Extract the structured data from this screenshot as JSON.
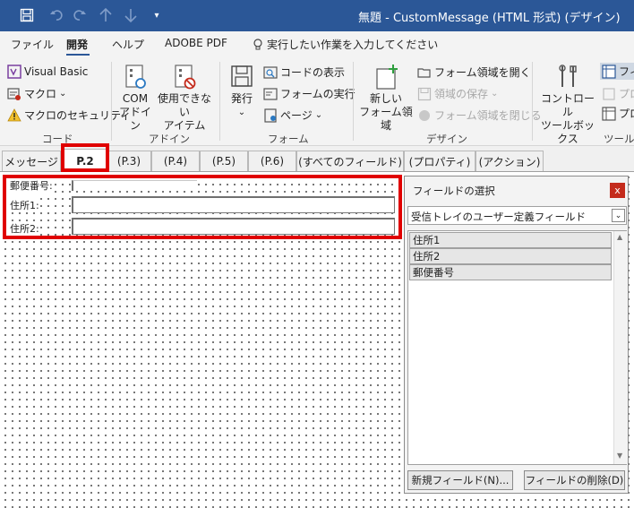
{
  "window": {
    "title": "無題 - CustomMessage (HTML 形式) (デザイン)",
    "quick_access": [
      "save-icon",
      "undo-icon",
      "redo-icon",
      "up-arrow-icon",
      "down-arrow-icon",
      "customize-qat-icon"
    ],
    "qat_glyphs": {
      "save": "🖫",
      "undo": "↶",
      "redo": "↻",
      "up": "↑",
      "down": "↓",
      "customize": "▾"
    },
    "accent_color": "#2b5797"
  },
  "menu": {
    "items": [
      "ファイル",
      "開発",
      "ヘルプ",
      "ADOBE PDF"
    ],
    "active": "開発",
    "tell_me": "実行したい作業を入力してください"
  },
  "ribbon": {
    "code": {
      "label": "コード",
      "visual_basic": "Visual Basic",
      "macro": "マクロ",
      "macro_security": "マクロのセキュリティ"
    },
    "addins": {
      "label": "アドイン",
      "com_addins_line1": "COM",
      "com_addins_line2": "アドイン",
      "disabled_items_line1": "使用できない",
      "disabled_items_line2": "アイテム"
    },
    "form": {
      "label": "フォーム",
      "publish": "発行",
      "view_code": "コードの表示",
      "run_form": "フォームの実行",
      "page": "ページ"
    },
    "design": {
      "label": "デザイン",
      "new_region_line1": "新しい",
      "new_region_line2": "フォーム領域",
      "open_region": "フォーム領域を開く",
      "save_region": "領域の保存",
      "close_region": "フォーム領域を閉じる"
    },
    "tools": {
      "label": "ツール",
      "control_toolbox_line1": "コントロール",
      "control_toolbox_line2": "ツールボックス",
      "field_chooser_partial": "フィー",
      "properties_partial": "プロ",
      "properties2_partial": "プロ"
    },
    "caret": "⌄",
    "dropdown_caret": "⌄"
  },
  "page_tabs": {
    "items": [
      "メッセージ",
      "P.2",
      "(P.3)",
      "(P.4)",
      "(P.5)",
      "(P.6)",
      "(すべてのフィールド)",
      "(プロパティ)",
      "(アクション)"
    ],
    "active": "P.2",
    "highlight_color": "#e00000"
  },
  "form_fields": [
    {
      "label": "郵便番号:",
      "value": ""
    },
    {
      "label": "住所1:",
      "value": ""
    },
    {
      "label": "住所2:",
      "value": ""
    }
  ],
  "field_chooser": {
    "title": "フィールドの選択",
    "close": "x",
    "selected_set": "受信トレイのユーザー定義フィールド",
    "dropdown_arrow": "⌄",
    "fields": [
      "住所1",
      "住所2",
      "郵便番号"
    ],
    "scroll_up": "▲",
    "scroll_down": "▼",
    "new_field_button": "新規フィールド(N)...",
    "delete_field_button": "フィールドの削除(D)"
  }
}
